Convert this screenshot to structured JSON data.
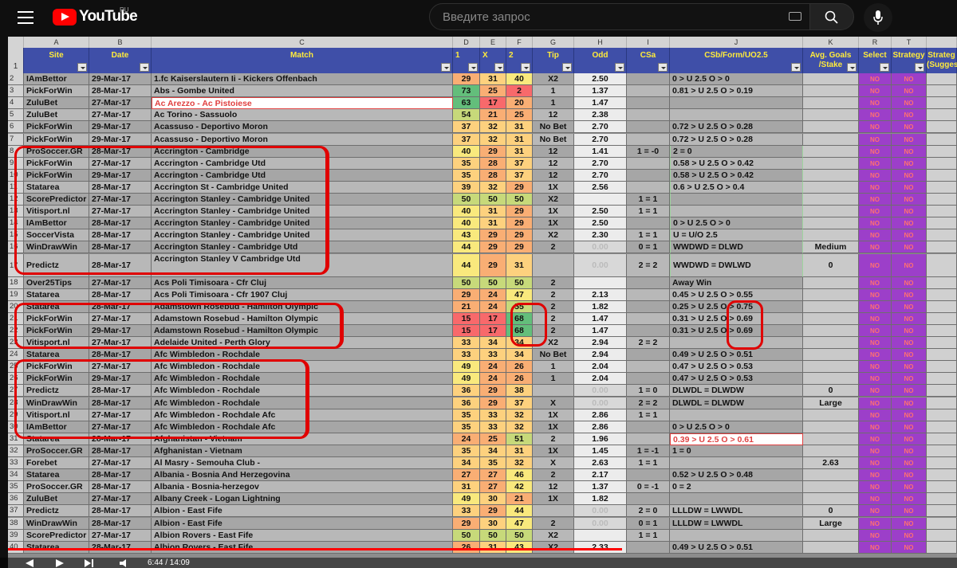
{
  "app": {
    "logo_text": "YouTube",
    "region": "RU",
    "search_placeholder": "Введите запрос",
    "time": "6:44 / 14:09"
  },
  "colors": {
    "accent": "#ff0000",
    "header_bg": "#3f4fa8",
    "header_text": "#ffeb3b",
    "select_bg": "#9c3fc9"
  },
  "icons": [
    "menu-icon",
    "youtube-logo-icon",
    "keyboard-icon",
    "search-icon",
    "mic-icon",
    "play-icon",
    "next-icon",
    "volume-icon"
  ],
  "col_letters": [
    "A",
    "B",
    "C",
    "D",
    "E",
    "F",
    "G",
    "H",
    "I",
    "J",
    "K",
    "R",
    "T",
    ""
  ],
  "headers": [
    "Site",
    "Date",
    "Match",
    "1",
    "X",
    "2",
    "Tip",
    "Odd",
    "CSa",
    "CSb/Form/UO2.5",
    "Avg. Goals /Stake",
    "Select",
    "Strategy",
    "Strateg (Sugges"
  ],
  "rows": [
    {
      "n": "2",
      "site": "IAmBettor",
      "date": "29-Mar-17",
      "match": "1.fc Kaiserslautern Ii - Kickers Offenbach",
      "p1": "29",
      "px": "31",
      "p2": "40",
      "tip": "X2",
      "odd": "2.50",
      "csa": "",
      "csb": "0 > U 2.5 O > 0",
      "avg": ""
    },
    {
      "n": "3",
      "site": "PickForWin",
      "date": "28-Mar-17",
      "match": "Abs - Gombe United",
      "p1": "73",
      "px": "25",
      "p2": "2",
      "tip": "1",
      "odd": "1.37",
      "csa": "",
      "csb": "0.81 > U 2.5 O > 0.19",
      "avg": ""
    },
    {
      "n": "4",
      "site": "ZuluBet",
      "date": "27-Mar-17",
      "match": "Ac Arezzo - Ac Pistoiese",
      "p1": "63",
      "px": "17",
      "p2": "20",
      "tip": "1",
      "odd": "1.47",
      "csa": "",
      "csb": "",
      "avg": ""
    },
    {
      "n": "5",
      "site": "ZuluBet",
      "date": "27-Mar-17",
      "match": "Ac Torino - Sassuolo",
      "p1": "54",
      "px": "21",
      "p2": "25",
      "tip": "12",
      "odd": "2.38",
      "csa": "",
      "csb": "",
      "avg": ""
    },
    {
      "n": "6",
      "site": "PickForWin",
      "date": "29-Mar-17",
      "match": "Acassuso - Deportivo Moron",
      "p1": "37",
      "px": "32",
      "p2": "31",
      "tip": "No Bet",
      "odd": "2.70",
      "csa": "",
      "csb": "0.72 > U 2.5 O > 0.28",
      "avg": ""
    },
    {
      "n": "7",
      "site": "PickForWin",
      "date": "29-Mar-17",
      "match": "Acassuso - Deportivo Moron",
      "p1": "37",
      "px": "32",
      "p2": "31",
      "tip": "No Bet",
      "odd": "2.70",
      "csa": "",
      "csb": "0.72 > U 2.5 O > 0.28",
      "avg": ""
    },
    {
      "n": "8",
      "site": "ProSoccer.GR",
      "date": "28-Mar-17",
      "match": "Accrington - Cambridge",
      "p1": "40",
      "px": "29",
      "p2": "31",
      "tip": "12",
      "odd": "1.41",
      "csa": "1 = -0",
      "csb": "2 = 0",
      "avg": ""
    },
    {
      "n": "9",
      "site": "PickForWin",
      "date": "27-Mar-17",
      "match": "Accrington - Cambridge Utd",
      "p1": "35",
      "px": "28",
      "p2": "37",
      "tip": "12",
      "odd": "2.70",
      "csa": "",
      "csb": "0.58 > U 2.5 O > 0.42",
      "avg": ""
    },
    {
      "n": "10",
      "site": "PickForWin",
      "date": "29-Mar-17",
      "match": "Accrington - Cambridge Utd",
      "p1": "35",
      "px": "28",
      "p2": "37",
      "tip": "12",
      "odd": "2.70",
      "csa": "",
      "csb": "0.58 > U 2.5 O > 0.42",
      "avg": ""
    },
    {
      "n": "11",
      "site": "Statarea",
      "date": "28-Mar-17",
      "match": "Accrington St - Cambridge United",
      "p1": "39",
      "px": "32",
      "p2": "29",
      "tip": "1X",
      "odd": "2.56",
      "csa": "",
      "csb": "0.6 > U 2.5 O > 0.4",
      "avg": ""
    },
    {
      "n": "12",
      "site": "ScorePredictor",
      "date": "27-Mar-17",
      "match": "Accrington Stanley  - Cambridge United",
      "p1": "50",
      "px": "50",
      "p2": "50",
      "tip": "X2",
      "odd": "",
      "csa": "1 = 1",
      "csb": "",
      "avg": ""
    },
    {
      "n": "13",
      "site": "Vitisport.nl",
      "date": "27-Mar-17",
      "match": "Accrington Stanley - Cambridge United",
      "p1": "40",
      "px": "31",
      "p2": "29",
      "tip": "1X",
      "odd": "2.50",
      "csa": "1 = 1",
      "csb": "",
      "avg": ""
    },
    {
      "n": "14",
      "site": "IAmBettor",
      "date": "28-Mar-17",
      "match": "Accrington Stanley - Cambridge United",
      "p1": "40",
      "px": "31",
      "p2": "29",
      "tip": "1X",
      "odd": "2.50",
      "csa": "",
      "csb": "0 > U 2.5 O > 0",
      "avg": ""
    },
    {
      "n": "15",
      "site": "SoccerVista",
      "date": "28-Mar-17",
      "match": "Accrington Stanley - Cambridge United",
      "p1": "43",
      "px": "29",
      "p2": "29",
      "tip": "X2",
      "odd": "2.30",
      "csa": "1 = 1",
      "csb": "U = U/O 2.5",
      "avg": ""
    },
    {
      "n": "16",
      "site": "WinDrawWin",
      "date": "28-Mar-17",
      "match": "Accrington Stanley - Cambridge Utd",
      "p1": "44",
      "px": "29",
      "p2": "29",
      "tip": "2",
      "odd": "0.00",
      "csa": "0 = 1",
      "csb": "WWDWD = DLWD",
      "avg": "Medium"
    },
    {
      "n": "17",
      "site": "Predictz",
      "date": "28-Mar-17",
      "match": "Accrington Stanley V Cambridge Utd",
      "p1": "44",
      "px": "29",
      "p2": "31",
      "tip": "",
      "odd": "0.00",
      "csa": "2 = 2",
      "csb": "WWDWD = DWLWD",
      "avg": "0"
    },
    {
      "n": "18",
      "site": "Over25Tips",
      "date": "27-Mar-17",
      "match": "Acs Poli Timisoara  - Cfr Cluj",
      "p1": "50",
      "px": "50",
      "p2": "50",
      "tip": "2",
      "odd": "",
      "csa": "",
      "csb": "Away Win",
      "avg": ""
    },
    {
      "n": "19",
      "site": "Statarea",
      "date": "28-Mar-17",
      "match": "Acs Poli Timisoara - Cfr 1907 Cluj",
      "p1": "29",
      "px": "24",
      "p2": "47",
      "tip": "2",
      "odd": "2.13",
      "csa": "",
      "csb": "0.45 > U 2.5 O > 0.55",
      "avg": ""
    },
    {
      "n": "20",
      "site": "Statarea",
      "date": "28-Mar-17",
      "match": "Adamstown Rosebud - Hamilton Olympic",
      "p1": "21",
      "px": "24",
      "p2": "55",
      "tip": "2",
      "odd": "1.82",
      "csa": "",
      "csb": "0.25 > U 2.5 O > 0.75",
      "avg": ""
    },
    {
      "n": "21",
      "site": "PickForWin",
      "date": "27-Mar-17",
      "match": "Adamstown Rosebud - Hamilton Olympic",
      "p1": "15",
      "px": "17",
      "p2": "68",
      "tip": "2",
      "odd": "1.47",
      "csa": "",
      "csb": "0.31 > U 2.5 O > 0.69",
      "avg": ""
    },
    {
      "n": "22",
      "site": "PickForWin",
      "date": "29-Mar-17",
      "match": "Adamstown Rosebud - Hamilton Olympic",
      "p1": "15",
      "px": "17",
      "p2": "68",
      "tip": "2",
      "odd": "1.47",
      "csa": "",
      "csb": "0.31 > U 2.5 O > 0.69",
      "avg": ""
    },
    {
      "n": "23",
      "site": "Vitisport.nl",
      "date": "27-Mar-17",
      "match": "Adelaide United - Perth Glory",
      "p1": "33",
      "px": "34",
      "p2": "34",
      "tip": "X2",
      "odd": "2.94",
      "csa": "2 = 2",
      "csb": "",
      "avg": ""
    },
    {
      "n": "24",
      "site": "Statarea",
      "date": "28-Mar-17",
      "match": "Afc Wimbledon - Rochdale",
      "p1": "33",
      "px": "33",
      "p2": "34",
      "tip": "No Bet",
      "odd": "2.94",
      "csa": "",
      "csb": "0.49 > U 2.5 O > 0.51",
      "avg": ""
    },
    {
      "n": "25",
      "site": "PickForWin",
      "date": "27-Mar-17",
      "match": "Afc Wimbledon - Rochdale",
      "p1": "49",
      "px": "24",
      "p2": "26",
      "tip": "1",
      "odd": "2.04",
      "csa": "",
      "csb": "0.47 > U 2.5 O > 0.53",
      "avg": ""
    },
    {
      "n": "26",
      "site": "PickForWin",
      "date": "29-Mar-17",
      "match": "Afc Wimbledon - Rochdale",
      "p1": "49",
      "px": "24",
      "p2": "26",
      "tip": "1",
      "odd": "2.04",
      "csa": "",
      "csb": "0.47 > U 2.5 O > 0.53",
      "avg": ""
    },
    {
      "n": "27",
      "site": "Predictz",
      "date": "28-Mar-17",
      "match": "Afc Wimbledon - Rochdale",
      "p1": "36",
      "px": "29",
      "p2": "38",
      "tip": "",
      "odd": "0.00",
      "csa": "1 = 0",
      "csb": "DLWDL = DLWDW",
      "avg": "0"
    },
    {
      "n": "28",
      "site": "WinDrawWin",
      "date": "28-Mar-17",
      "match": "Afc Wimbledon - Rochdale",
      "p1": "36",
      "px": "29",
      "p2": "37",
      "tip": "X",
      "odd": "0.00",
      "csa": "2 = 2",
      "csb": "DLWDL = DLWDW",
      "avg": "Large"
    },
    {
      "n": "29",
      "site": "Vitisport.nl",
      "date": "27-Mar-17",
      "match": "Afc Wimbledon - Rochdale Afc",
      "p1": "35",
      "px": "33",
      "p2": "32",
      "tip": "1X",
      "odd": "2.86",
      "csa": "1 = 1",
      "csb": "",
      "avg": ""
    },
    {
      "n": "30",
      "site": "IAmBettor",
      "date": "27-Mar-17",
      "match": "Afc Wimbledon - Rochdale Afc",
      "p1": "35",
      "px": "33",
      "p2": "32",
      "tip": "1X",
      "odd": "2.86",
      "csa": "",
      "csb": "0 > U 2.5 O > 0",
      "avg": ""
    },
    {
      "n": "31",
      "site": "Statarea",
      "date": "28-Mar-17",
      "match": "Afghanistan - Vietnam",
      "p1": "24",
      "px": "25",
      "p2": "51",
      "tip": "2",
      "odd": "1.96",
      "csa": "",
      "csb": "0.39 > U 2.5 O > 0.61",
      "avg": ""
    },
    {
      "n": "32",
      "site": "ProSoccer.GR",
      "date": "28-Mar-17",
      "match": "Afghanistan - Vietnam",
      "p1": "35",
      "px": "34",
      "p2": "31",
      "tip": "1X",
      "odd": "1.45",
      "csa": "1 = -1",
      "csb": "1 = 0",
      "avg": ""
    },
    {
      "n": "33",
      "site": "Forebet",
      "date": "27-Mar-17",
      "match": "Al Masry - Semouha Club -",
      "p1": "34",
      "px": "35",
      "p2": "32",
      "tip": "X",
      "odd": "2.63",
      "csa": "1 = 1",
      "csb": "",
      "avg": "2.63"
    },
    {
      "n": "34",
      "site": "Statarea",
      "date": "28-Mar-17",
      "match": "Albania - Bosnia And Herzegovina",
      "p1": "27",
      "px": "27",
      "p2": "46",
      "tip": "2",
      "odd": "2.17",
      "csa": "",
      "csb": "0.52 > U 2.5 O > 0.48",
      "avg": ""
    },
    {
      "n": "35",
      "site": "ProSoccer.GR",
      "date": "28-Mar-17",
      "match": "Albania - Bosnia-herzegov",
      "p1": "31",
      "px": "27",
      "p2": "42",
      "tip": "12",
      "odd": "1.37",
      "csa": "0 = -1",
      "csb": "0 = 2",
      "avg": ""
    },
    {
      "n": "36",
      "site": "ZuluBet",
      "date": "27-Mar-17",
      "match": "Albany Creek - Logan Lightning",
      "p1": "49",
      "px": "30",
      "p2": "21",
      "tip": "1X",
      "odd": "1.82",
      "csa": "",
      "csb": "",
      "avg": ""
    },
    {
      "n": "37",
      "site": "Predictz",
      "date": "28-Mar-17",
      "match": "Albion - East Fife",
      "p1": "33",
      "px": "29",
      "p2": "44",
      "tip": "",
      "odd": "0.00",
      "csa": "2 = 0",
      "csb": "LLLDW = LWWDL",
      "avg": "0"
    },
    {
      "n": "38",
      "site": "WinDrawWin",
      "date": "28-Mar-17",
      "match": "Albion - East Fife",
      "p1": "29",
      "px": "30",
      "p2": "47",
      "tip": "2",
      "odd": "0.00",
      "csa": "0 = 1",
      "csb": "LLLDW = LWWDL",
      "avg": "Large"
    },
    {
      "n": "39",
      "site": "ScorePredictor",
      "date": "27-Mar-17",
      "match": "Albion Rovers  - East Fife",
      "p1": "50",
      "px": "50",
      "p2": "50",
      "tip": "X2",
      "odd": "",
      "csa": "1 = 1",
      "csb": "",
      "avg": ""
    },
    {
      "n": "40",
      "site": "Statarea",
      "date": "28-Mar-17",
      "match": "Albion Rovers - East Fife",
      "p1": "26",
      "px": "31",
      "p2": "43",
      "tip": "X2",
      "odd": "2.33",
      "csa": "",
      "csb": "0.49 > U 2.5 O > 0.51",
      "avg": ""
    }
  ],
  "select_value": "NO"
}
